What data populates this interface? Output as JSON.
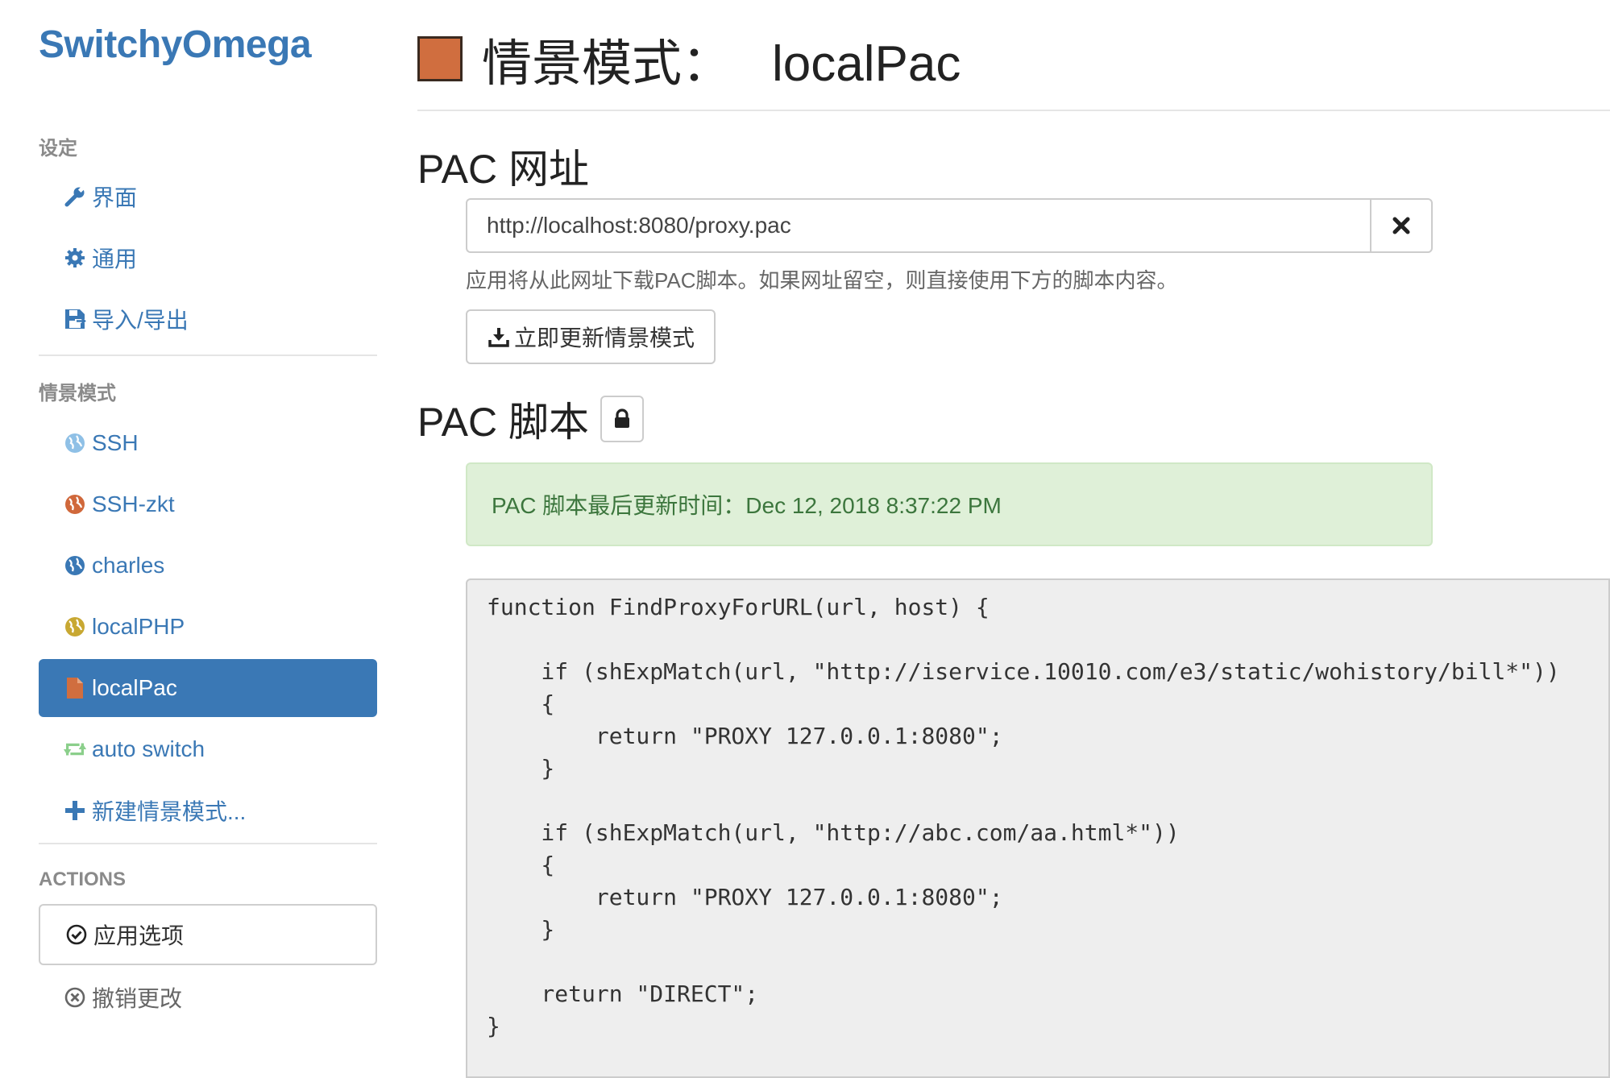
{
  "brand": "SwitchyOmega",
  "settings": {
    "title": "设定",
    "items": [
      {
        "label": "界面",
        "icon": "wrench-icon"
      },
      {
        "label": "通用",
        "icon": "gear-icon"
      },
      {
        "label": "导入/导出",
        "icon": "floppy-disk-icon"
      }
    ]
  },
  "profiles": {
    "title": "情景模式",
    "items": [
      {
        "label": "SSH",
        "icon": "globe-icon",
        "color": "#8fc0e6"
      },
      {
        "label": "SSH-zkt",
        "icon": "globe-icon",
        "color": "#d0683b"
      },
      {
        "label": "charles",
        "icon": "globe-icon",
        "color": "#3a78b5"
      },
      {
        "label": "localPHP",
        "icon": "globe-icon",
        "color": "#c8a832"
      },
      {
        "label": "localPac",
        "icon": "pac-file-icon",
        "color": "#d06e3f",
        "active": true
      },
      {
        "label": "auto switch",
        "icon": "retweet-icon",
        "color": "#8bcf8b"
      },
      {
        "label": "新建情景模式...",
        "icon": "plus-icon",
        "color": "#3a78b5"
      }
    ]
  },
  "actions": {
    "title": "ACTIONS",
    "apply_label": "应用选项",
    "discard_label": "撤销更改"
  },
  "header": {
    "title_prefix": "情景模式：",
    "profile_name": "localPac",
    "profile_color": "#d06e3f"
  },
  "pac_url": {
    "heading": "PAC 网址",
    "value": "http://localhost:8080/proxy.pac",
    "help": "应用将从此网址下载PAC脚本。如果网址留空，则直接使用下方的脚本内容。",
    "update_label": "立即更新情景模式"
  },
  "pac_script": {
    "heading": "PAC 脚本",
    "last_updated": "PAC 脚本最后更新时间：Dec 12, 2018 8:37:22 PM",
    "code": "function FindProxyForURL(url, host) {\n\n    if (shExpMatch(url, \"http://iservice.10010.com/e3/static/wohistory/bill*\"))\n    {\n        return \"PROXY 127.0.0.1:8080\";\n    }\n\n    if (shExpMatch(url, \"http://abc.com/aa.html*\"))\n    {\n        return \"PROXY 127.0.0.1:8080\";\n    }\n\n    return \"DIRECT\";\n}"
  }
}
